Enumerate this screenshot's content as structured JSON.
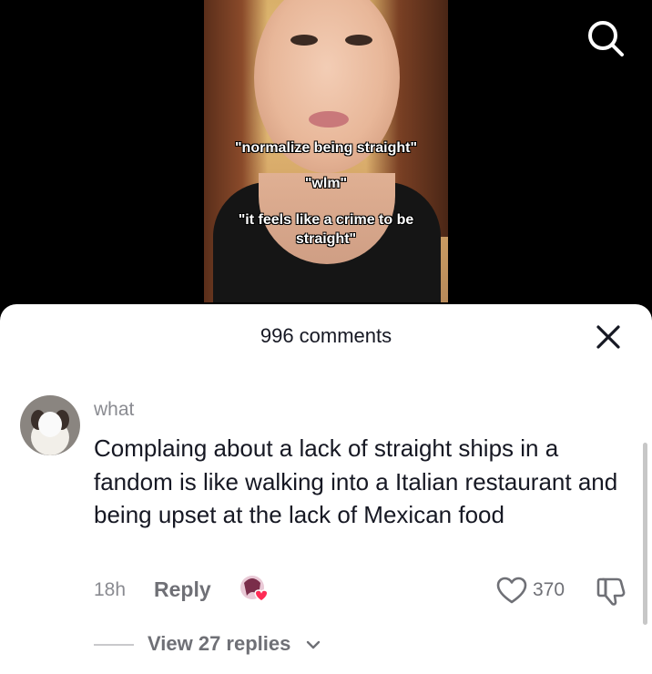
{
  "video": {
    "captions": [
      "\"normalize being straight\"",
      "\"wlm\"",
      "\"it feels like a crime to be",
      "straight\""
    ]
  },
  "comments_sheet": {
    "title": "996 comments"
  },
  "comment": {
    "username": "what",
    "text": "Complaing about a lack of straight ships in a fandom is like walking into a Italian restaurant and being upset at the lack of Mexican food",
    "time": "18h",
    "reply_label": "Reply",
    "like_count": "370",
    "view_replies": "View 27 replies"
  },
  "icons": {
    "search": "search-icon",
    "close": "close-icon",
    "like": "heart-outline-icon",
    "dislike": "thumbs-down-icon",
    "chevron": "chevron-down-icon",
    "creator_liked": "creator-liked-badge"
  },
  "colors": {
    "accent_like": "#fe2c55",
    "text_primary": "#161823",
    "text_secondary": "#8a8b91"
  }
}
